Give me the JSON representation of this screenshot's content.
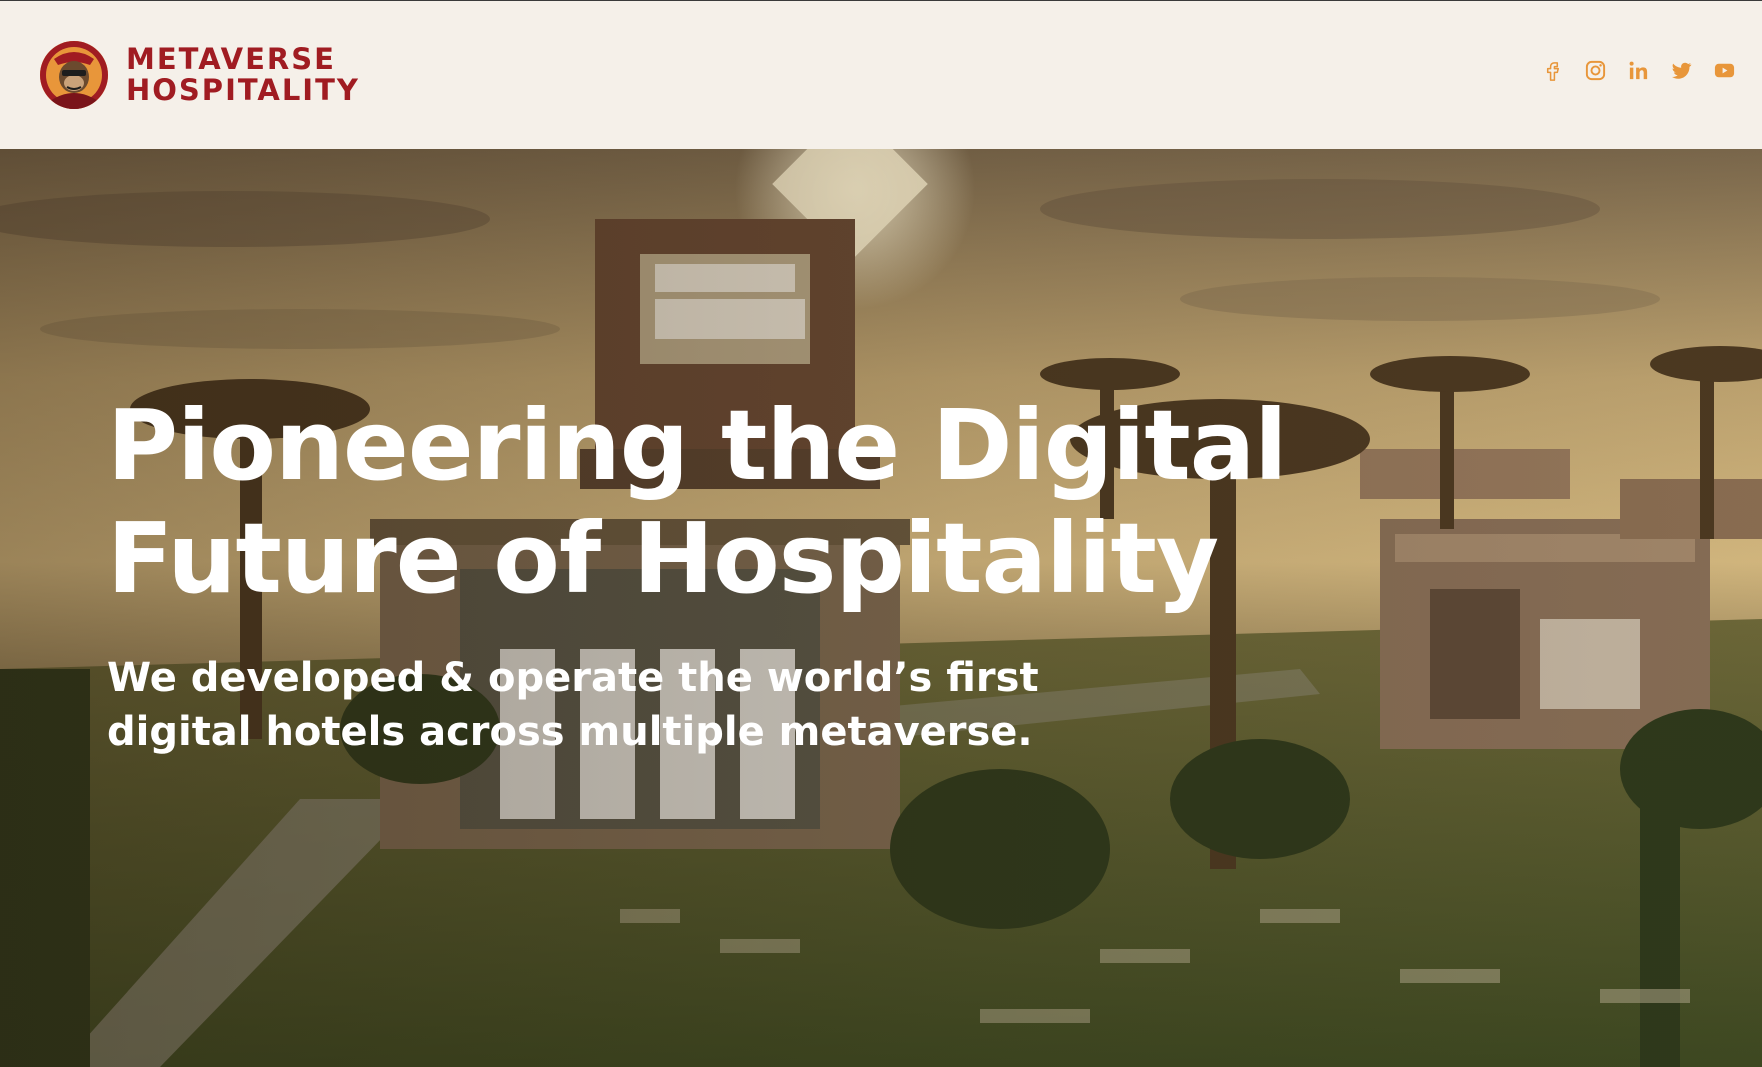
{
  "header": {
    "brand": {
      "line1": "METAVERSE",
      "line2": "HOSPITALITY"
    },
    "social": [
      {
        "icon": "facebook-icon"
      },
      {
        "icon": "instagram-icon"
      },
      {
        "icon": "linkedin-icon"
      },
      {
        "icon": "twitter-icon"
      },
      {
        "icon": "youtube-icon"
      }
    ]
  },
  "hero": {
    "title_line1": "Pioneering the Digital",
    "title_line2": "Future of Hospitality",
    "subtitle_line1": "We developed & operate the world’s first",
    "subtitle_line2": "digital hotels across multiple metaverse."
  },
  "colors": {
    "brand": "#a01c22",
    "accent": "#e8963a",
    "header_bg": "#f5f0e9",
    "hero_text": "#ffffff"
  }
}
